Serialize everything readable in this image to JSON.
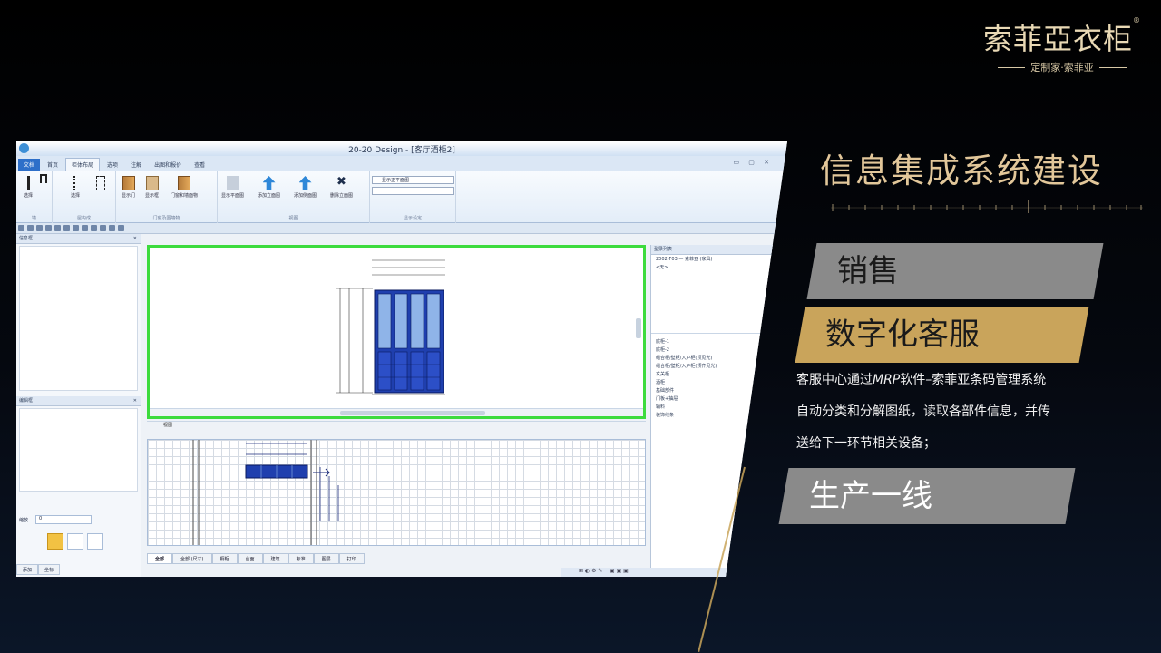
{
  "brand": {
    "name": "索菲亞衣柜",
    "reg": "®",
    "tagline": "定制家·索菲亚"
  },
  "heading": "信息集成系统建设",
  "sections": [
    {
      "label": "销售",
      "style": "gray"
    },
    {
      "label": "数字化客服",
      "style": "gold"
    },
    {
      "label": "生产一线",
      "style": "gray"
    }
  ],
  "description": {
    "line1_pre": "客服中心通过",
    "line1_em": "MRP",
    "line1_post": "软件–索菲亚条码管理系统",
    "line2": "自动分类和分解图纸，读取各部件信息，并传",
    "line3": "送给下一环节相关设备；"
  },
  "app": {
    "title": "20-20 Design - [客厅酒柜2]",
    "tabs": [
      "文档",
      "首页",
      "柜体布局",
      "选项",
      "注解",
      "出图和报价",
      "查看"
    ],
    "active_tab": 2,
    "ribbon_groups": [
      "墙",
      "屋构成",
      "门窗及围墙物",
      "视图",
      "显示设定"
    ],
    "ribbon_buttons": [
      "选择",
      "选择",
      "显示门",
      "显示框",
      "门窗和墙面物",
      "显示平面图",
      "添加立面图",
      "添加侧面图",
      "删除立面图"
    ],
    "view_combo": "显示正平面图",
    "left_panel_top": "信息框",
    "left_panel_bottom": "编辑框",
    "zoom_label": "缩放",
    "zoom_value": "0",
    "left_tabs": [
      "添加",
      "坐标"
    ],
    "view_tab": "视图",
    "bottom_tabs": [
      "全部",
      "全部 (尺寸)",
      "橱柜",
      "台面",
      "建筑",
      "标准",
      "图层",
      "打印"
    ],
    "right_panel": {
      "header": "型录列表",
      "item": "2002-F03 — 索菲亚 (家具)",
      "sub": "<无>",
      "list": [
        "底柜-1",
        "底柜-2",
        "组合柜/壁柜/入户柜(顶见光)",
        "组合柜/壁柜/入户柜(顶齐见光)",
        "玄关柜",
        "酒柜",
        "基础部件",
        "门板+抽屉",
        "辅料",
        "装饰线条"
      ]
    }
  }
}
